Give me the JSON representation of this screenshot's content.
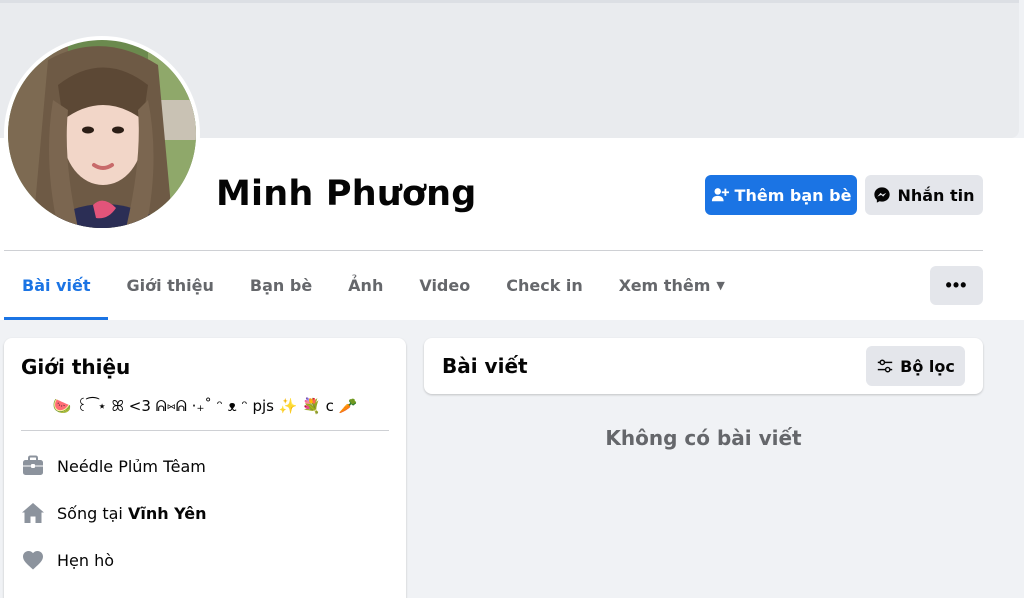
{
  "profile": {
    "name": "Minh Phương",
    "add_friend_label": "Thêm bạn bè",
    "message_label": "Nhắn tin"
  },
  "tabs": [
    {
      "label": "Bài viết"
    },
    {
      "label": "Giới thiệu"
    },
    {
      "label": "Bạn bè"
    },
    {
      "label": "Ảnh"
    },
    {
      "label": "Video"
    },
    {
      "label": "Check in"
    },
    {
      "label": "Xem thêm"
    }
  ],
  "more_label": "•••",
  "intro": {
    "title": "Giới thiệu",
    "bio": "🍉 ꒰ ͡ ⋆ ꕤ <3 ᕱ⑅ᕱ ‧₊˚ ᵔ ᴥ ᵔ pjs ✨ 💐 c 🥕",
    "work": "Neédle Plủm Têam",
    "lives_prefix": "Sống tại",
    "lives_city": "Vĩnh Yên",
    "relationship": "Hẹn hò"
  },
  "posts": {
    "title": "Bài viết",
    "filter_label": "Bộ lọc",
    "empty_message": "Không có bài viết"
  },
  "colors": {
    "accent": "#1b74e4",
    "secondary_bg": "#e4e6eb",
    "page_bg": "#f0f2f5",
    "muted_text": "#65676b"
  },
  "icons": {
    "add_friend": "person-plus-icon",
    "message": "messenger-icon",
    "filter": "sliders-icon",
    "work": "briefcase-icon",
    "home": "home-icon",
    "relationship": "heart-icon",
    "dropdown": "caret-down-icon"
  }
}
